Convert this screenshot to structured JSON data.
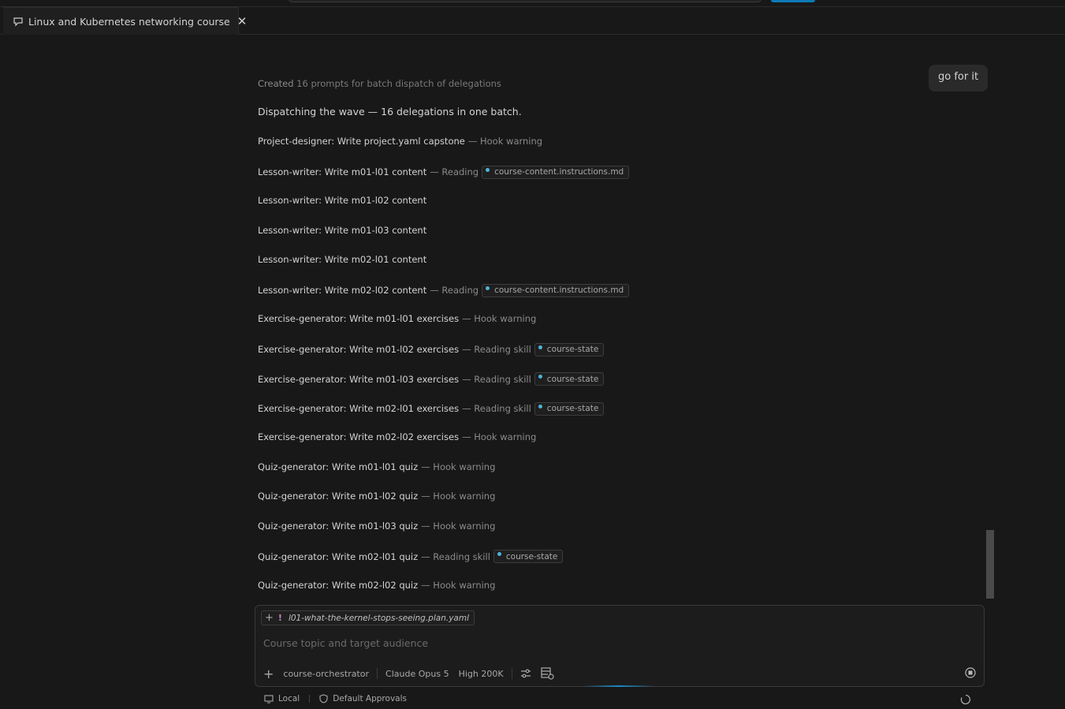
{
  "tab": {
    "title": "Linux and Kubernetes networking course",
    "icon": "chat-icon",
    "close_icon": "close-icon"
  },
  "user_message": "go for it",
  "status_line": {
    "verb": "Created",
    "detail": "16 prompts for batch dispatch of delegations"
  },
  "dispatch_text": "Dispatching the wave — 16 delegations in one batch.",
  "delegations": [
    {
      "task": "Project-designer: Write project.yaml capstone",
      "status": "— Hook warning",
      "chip": ""
    },
    {
      "task": "Lesson-writer: Write m01-l01 content",
      "status": "— Reading",
      "chip": "course-content.instructions.md"
    },
    {
      "task": "Lesson-writer: Write m01-l02 content",
      "status": "",
      "chip": ""
    },
    {
      "task": "Lesson-writer: Write m01-l03 content",
      "status": "",
      "chip": ""
    },
    {
      "task": "Lesson-writer: Write m02-l01 content",
      "status": "",
      "chip": ""
    },
    {
      "task": "Lesson-writer: Write m02-l02 content",
      "status": "— Reading",
      "chip": "course-content.instructions.md"
    },
    {
      "task": "Exercise-generator: Write m01-l01 exercises",
      "status": "— Hook warning",
      "chip": ""
    },
    {
      "task": "Exercise-generator: Write m01-l02 exercises",
      "status": "— Reading skill",
      "chip": "course-state"
    },
    {
      "task": "Exercise-generator: Write m01-l03 exercises",
      "status": "— Reading skill",
      "chip": "course-state"
    },
    {
      "task": "Exercise-generator: Write m02-l01 exercises",
      "status": "— Reading skill",
      "chip": "course-state"
    },
    {
      "task": "Exercise-generator: Write m02-l02 exercises",
      "status": "— Hook warning",
      "chip": ""
    },
    {
      "task": "Quiz-generator: Write m01-l01 quiz",
      "status": "— Hook warning",
      "chip": ""
    },
    {
      "task": "Quiz-generator: Write m01-l02 quiz",
      "status": "— Hook warning",
      "chip": ""
    },
    {
      "task": "Quiz-generator: Write m01-l03 quiz",
      "status": "— Hook warning",
      "chip": ""
    },
    {
      "task": "Quiz-generator: Write m02-l01 quiz",
      "status": "— Reading skill",
      "chip": "course-state"
    },
    {
      "task": "Quiz-generator: Write m02-l02 quiz",
      "status": "— Hook warning",
      "chip": ""
    }
  ],
  "input": {
    "attachment": "l01-what-the-kernel-stops-seeing.plan.yaml",
    "placeholder": "Course topic and target audience",
    "agent": "course-orchestrator",
    "model": "Claude Opus 5",
    "effort": "High 200K"
  },
  "statusbar": {
    "location": "Local",
    "approvals": "Default Approvals"
  },
  "colors": {
    "background": "#181818",
    "accent": "#0e7ab8",
    "chip_dot": "#4fb3d9"
  }
}
